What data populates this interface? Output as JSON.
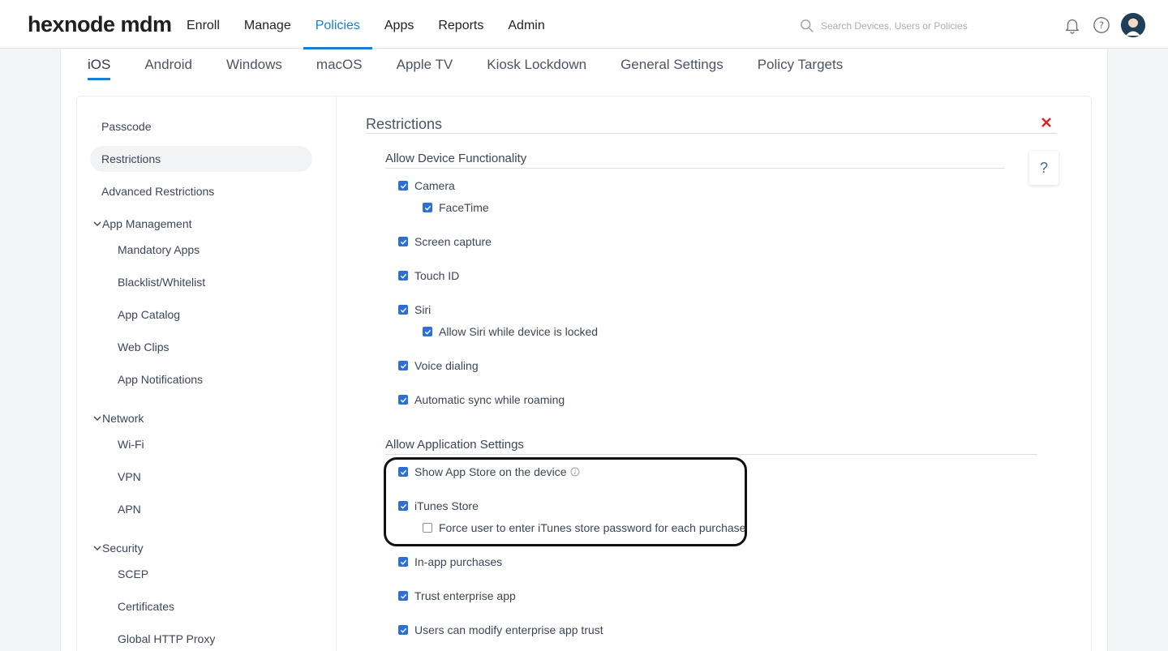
{
  "app": {
    "logo": "hexnode mdm"
  },
  "nav": {
    "items": [
      "Enroll",
      "Manage",
      "Policies",
      "Apps",
      "Reports",
      "Admin"
    ],
    "active": "Policies"
  },
  "search": {
    "placeholder": "Search Devices, Users or Policies"
  },
  "subtabs": {
    "items": [
      "iOS",
      "Android",
      "Windows",
      "macOS",
      "Apple TV",
      "Kiosk Lockdown",
      "General Settings",
      "Policy Targets"
    ],
    "active": "iOS"
  },
  "sidebar": {
    "passcode": "Passcode",
    "restrictions": "Restrictions",
    "advanced": "Advanced Restrictions",
    "app_management": {
      "label": "App Management",
      "items": [
        "Mandatory Apps",
        "Blacklist/Whitelist",
        "App Catalog",
        "Web Clips",
        "App Notifications"
      ]
    },
    "network": {
      "label": "Network",
      "items": [
        "Wi-Fi",
        "VPN",
        "APN"
      ]
    },
    "security": {
      "label": "Security",
      "items": [
        "SCEP",
        "Certificates",
        "Global HTTP Proxy"
      ]
    }
  },
  "content": {
    "title": "Restrictions",
    "help": "?",
    "device_functionality": {
      "title": "Allow Device Functionality",
      "options": [
        {
          "label": "Camera",
          "checked": true
        },
        {
          "label": "FaceTime",
          "checked": true
        },
        {
          "label": "Screen capture",
          "checked": true
        },
        {
          "label": "Touch ID",
          "checked": true
        },
        {
          "label": "Siri",
          "checked": true
        },
        {
          "label": "Allow Siri while device is locked",
          "checked": true
        },
        {
          "label": "Voice dialing",
          "checked": true
        },
        {
          "label": "Automatic sync while roaming",
          "checked": true
        }
      ]
    },
    "application_settings": {
      "title": "Allow Application Settings",
      "options": [
        {
          "label": "Show App Store on the device",
          "checked": true
        },
        {
          "label": "iTunes Store",
          "checked": true
        },
        {
          "label": "Force user to enter iTunes store password for each purchase",
          "checked": false
        },
        {
          "label": "In-app purchases",
          "checked": true
        },
        {
          "label": "Trust enterprise app",
          "checked": true
        },
        {
          "label": "Users can modify enterprise app trust",
          "checked": true
        }
      ]
    }
  },
  "colors": {
    "accent": "#1a7fd0",
    "checkbox": "#2d6fd6",
    "close": "#e02020"
  }
}
